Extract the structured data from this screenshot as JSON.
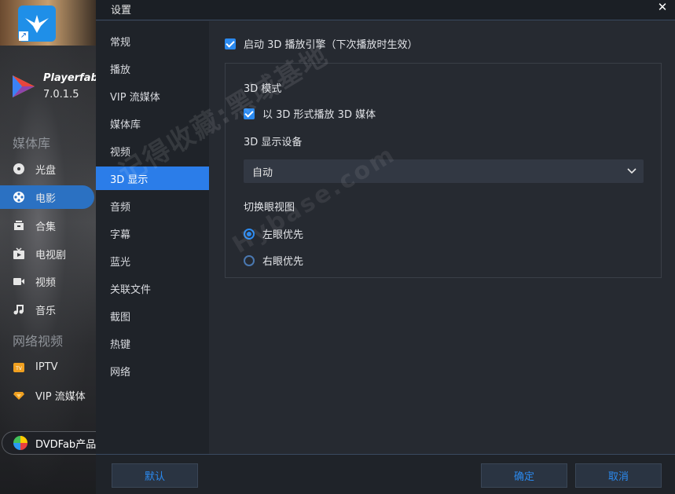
{
  "app": {
    "name": "Playerfab",
    "version": "7.0.1.5",
    "sections": {
      "library": "媒体库",
      "online": "网络视频"
    },
    "library_items": [
      {
        "label": "光盘",
        "icon": "disc-icon"
      },
      {
        "label": "电影",
        "icon": "film-reel-icon"
      },
      {
        "label": "合集",
        "icon": "collection-icon"
      },
      {
        "label": "电视剧",
        "icon": "tv-series-icon"
      },
      {
        "label": "视频",
        "icon": "video-camera-icon"
      },
      {
        "label": "音乐",
        "icon": "music-note-icon"
      }
    ],
    "online_items": [
      {
        "label": "IPTV",
        "icon": "tv-icon"
      },
      {
        "label": "VIP 流媒体",
        "icon": "diamond-icon"
      }
    ],
    "active_item": "电影",
    "product_button": "DVDFab产品"
  },
  "dialog": {
    "title": "设置",
    "close_glyph": "✕",
    "tabs": [
      "常规",
      "播放",
      "VIP 流媒体",
      "媒体库",
      "视频",
      "3D 显示",
      "音频",
      "字幕",
      "蓝光",
      "关联文件",
      "截图",
      "热键",
      "网络"
    ],
    "active_tab": "3D 显示",
    "enable_3d": {
      "label": "启动 3D 播放引擎（下次播放时生效）",
      "checked": true
    },
    "mode_section": {
      "label": "3D 模式",
      "play_3d": {
        "label": "以 3D 形式播放 3D 媒体",
        "checked": true
      }
    },
    "device_section": {
      "label": "3D 显示设备",
      "selected": "自动"
    },
    "eye_view": {
      "label": "切换眼视图",
      "options": [
        {
          "label": "左眼优先",
          "selected": true
        },
        {
          "label": "右眼优先",
          "selected": false
        }
      ]
    },
    "footer": {
      "default_label": "默认",
      "ok_label": "确定",
      "cancel_label": "取消"
    }
  },
  "watermark": {
    "line1": "记得收藏:黑域基地",
    "line2": "Hybase.com"
  },
  "colors": {
    "accent": "#2b8af0",
    "active_tab": "#2b7de9",
    "sidebar_active": "#2b71c2"
  }
}
